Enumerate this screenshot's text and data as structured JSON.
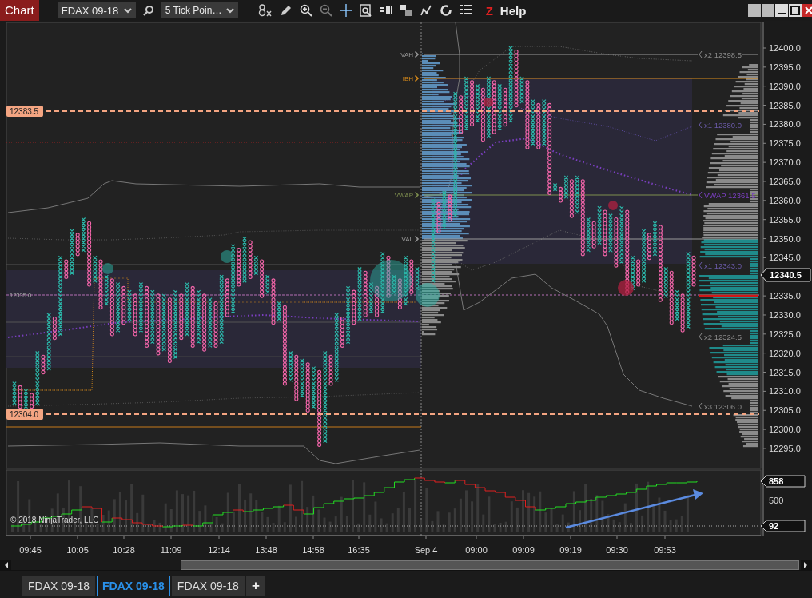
{
  "window": {
    "title": "Chart"
  },
  "toolbar": {
    "instrument": "FDAX 09-18",
    "chart_type": "5 Tick Poin…",
    "z_label": "Z",
    "help": "Help"
  },
  "price_axis": {
    "ticks": [
      "12400.0",
      "12395.0",
      "12390.0",
      "12385.0",
      "12380.0",
      "12375.0",
      "12370.0",
      "12365.0",
      "12360.0",
      "12355.0",
      "12350.0",
      "12345.0",
      "12335.0",
      "12330.0",
      "12325.0",
      "12320.0",
      "12315.0",
      "12310.0",
      "12305.0",
      "12300.0",
      "12295.0"
    ],
    "current_price": "12340.5"
  },
  "price_markers": [
    {
      "text": "12383.5",
      "kind": "box"
    },
    {
      "text": "12335.0",
      "kind": "plain"
    },
    {
      "text": "12304.0",
      "kind": "box"
    }
  ],
  "levels": [
    {
      "label": "VAH",
      "color": "#9a9a9a"
    },
    {
      "label": "IBH",
      "color": "#d98b1a"
    },
    {
      "label": "VWAP",
      "color": "#7f8f4f"
    },
    {
      "label": "VAL",
      "color": "#9a9a9a"
    }
  ],
  "band_labels": [
    {
      "text": "x2 12398.5",
      "color": "#8a8a8a"
    },
    {
      "text": "x1 12380.0",
      "color": "#6a5aa8"
    },
    {
      "text": "VWAP 12361.5",
      "color": "#7a3fc0"
    },
    {
      "text": "x1 12343.0",
      "color": "#6a5aa8"
    },
    {
      "text": "x2 12324.5",
      "color": "#8a8a8a"
    },
    {
      "text": "x3 12306.0",
      "color": "#8a8a8a"
    }
  ],
  "indicator": {
    "ticks": [
      "858",
      "500",
      "92"
    ],
    "copyright": "© 2018 NinjaTrader, LLC"
  },
  "time_axis": [
    "09:45",
    "10:05",
    "10:28",
    "11:09",
    "12:14",
    "13:48",
    "14:58",
    "16:35",
    "Sep 4",
    "09:00",
    "09:09",
    "09:19",
    "09:30",
    "09:53"
  ],
  "tabs": [
    {
      "label": "FDAX 09-18",
      "selected": false
    },
    {
      "label": "FDAX 09-18",
      "selected": true
    },
    {
      "label": "FDAX 09-18",
      "selected": false
    }
  ],
  "add_tab": "+"
}
